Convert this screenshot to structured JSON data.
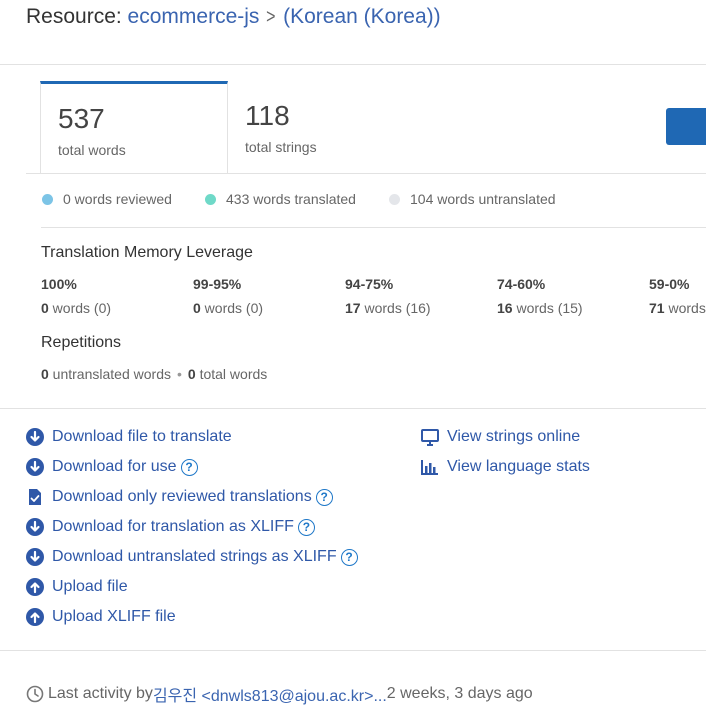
{
  "header": {
    "prefix": "Resource: ",
    "resource": "ecommerce-js",
    "language": "(Korean (Korea))"
  },
  "stats": {
    "total_words": "537",
    "total_words_label": "total words",
    "total_strings": "118",
    "total_strings_label": "total strings"
  },
  "legend": {
    "reviewed": "0 words reviewed",
    "translated": "433 words translated",
    "untranslated": "104 words untranslated",
    "colors": {
      "reviewed": "#7cc4e6",
      "translated": "#6fd9c8",
      "untranslated": "#e4e6ea"
    }
  },
  "tm": {
    "title": "Translation Memory Leverage",
    "columns": [
      {
        "pct": "100%",
        "count": "0",
        "rest": " words (0)"
      },
      {
        "pct": "99-95%",
        "count": "0",
        "rest": " words (0)"
      },
      {
        "pct": "94-75%",
        "count": "17",
        "rest": " words (16)"
      },
      {
        "pct": "74-60%",
        "count": "16",
        "rest": " words (15)"
      },
      {
        "pct": "59-0%",
        "count": "71",
        "rest": " words"
      }
    ]
  },
  "repetitions": {
    "title": "Repetitions",
    "untranslated_count": "0",
    "untranslated_label": " untranslated words",
    "total_count": "0",
    "total_label": " total words"
  },
  "actions": {
    "download_file": "Download file to translate",
    "download_use": "Download for use",
    "download_reviewed": "Download only reviewed translations",
    "download_xliff": "Download for translation as XLIFF",
    "download_untranslated_xliff": "Download untranslated strings as XLIFF",
    "upload_file": "Upload file",
    "upload_xliff": "Upload XLIFF file",
    "view_strings": "View strings online",
    "view_stats": "View language stats",
    "help_glyph": "?"
  },
  "footer": {
    "prefix": "Last activity by ",
    "user": "김우진 <dnwls813@ajou.ac.kr>...",
    "time": " 2 weeks, 3 days ago"
  },
  "accent": "#1f68b4"
}
